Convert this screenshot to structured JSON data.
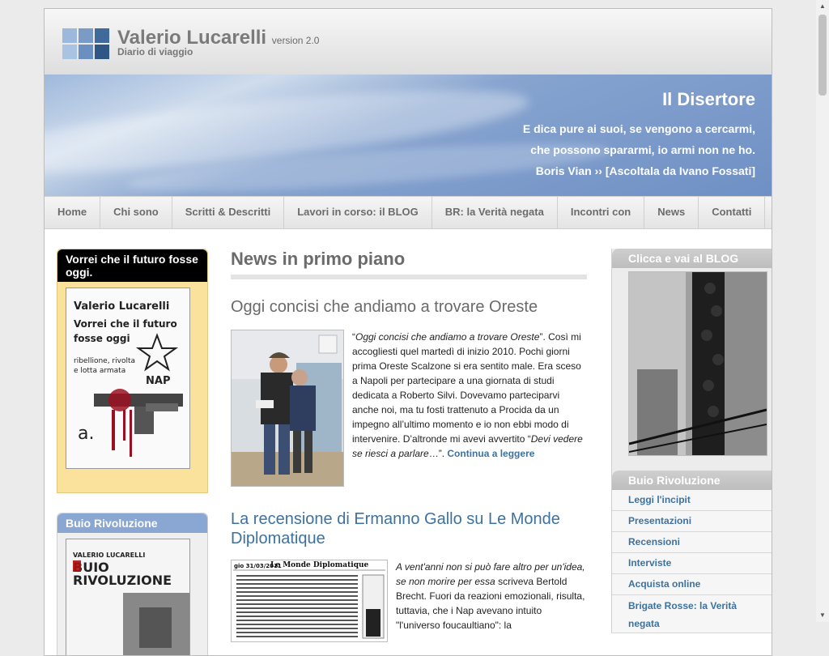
{
  "site": {
    "title": "Valerio Lucarelli",
    "version": "version 2.0",
    "tagline": "Diario di viaggio"
  },
  "banner": {
    "title": "Il Disertore",
    "line1": "E dica pure ai suoi, se vengono a cercarmi,",
    "line2": "che possono spararmi, io armi non ne ho.",
    "line3": "Boris Vian ››  [Ascoltala da Ivano Fossati]"
  },
  "nav": [
    {
      "label": "Home"
    },
    {
      "label": "Chi sono"
    },
    {
      "label": "Scritti & Descritti"
    },
    {
      "label": "Lavori in corso: il BLOG"
    },
    {
      "label": "BR: la Verità negata"
    },
    {
      "label": "Incontri con"
    },
    {
      "label": "News"
    },
    {
      "label": "Contatti"
    }
  ],
  "left": {
    "box1_title": "Vorrei che il futuro fosse oggi.",
    "cover1": {
      "author": "Valerio Lucarelli",
      "title1": "Vorrei che il futuro",
      "title2": "fosse oggi",
      "subtitle1": "ribellione, rivolta",
      "subtitle2": "e lotta armata",
      "badge": "NAP"
    },
    "box2_title": "Buio Rivoluzione",
    "cover2": {
      "author": "VALERIO LUCARELLI",
      "title1": "BUIO",
      "title2": "RIVOLUZIONE"
    }
  },
  "main": {
    "heading": "News in primo piano",
    "post1": {
      "title": "Oggi concisi che andiamo a trovare Oreste",
      "quote": "Oggi concisi che andiamo a trovare Oreste",
      "text1": "”. Così mi accogliesti quel martedì di inizio 2010. Pochi giorni prima Oreste Scalzone si era sentito male. Era sceso a Napoli per partecipare a una giornata di studi dedicata a Roberto Silvi. Dovevamo parteciparvi anche noi, ma tu fosti trattenuto a Procida da un impegno all’ultimo momento e io non ebbi modo di intervenire. D’altronde mi avevi avvertito “",
      "quote2": "Devi vedere se riesci a parlare",
      "text2": "…”. ",
      "more": "Continua a leggere"
    },
    "post2": {
      "title": "La recensione di Ermanno Gallo su Le Monde Diplomatique",
      "clip_date": "gio 31/03/2011",
      "clip_title": "Le Monde Diplomatique",
      "quote": "A vent'anni non si può fare altro per un'idea, se non morire per essa",
      "text": " scriveva Bertold Brecht. Fuori da reazioni emozionali, risulta, tuttavia, che i Nap avevano intuito \"l'universo foucaultiano\": la"
    }
  },
  "right": {
    "blog_title": "Clicca e vai al BLOG",
    "buio_title": "Buio Rivoluzione",
    "links": [
      "Leggi l'incipit",
      "Presentazioni",
      "Recensioni",
      "Interviste",
      "Acquista online",
      "Brigate Rosse: la Verità negata"
    ]
  },
  "colors": {
    "link": "#3d72a0",
    "banner": "#7d9bcc",
    "book_box": "#fbe29c"
  }
}
